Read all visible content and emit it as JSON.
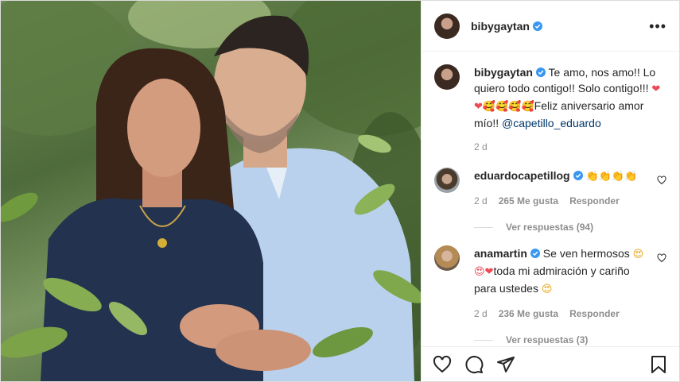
{
  "post": {
    "author": "bibygaytan",
    "caption": {
      "username": "bibygaytan",
      "text_part1": " Te amo, nos amo!! Lo quiero todo contigo!! Solo contigo!!! ",
      "emojis": "❤❤🥰🥰🥰🥰",
      "text_part2": "Feliz aniversario amor mío!! ",
      "mention": "@capetillo_eduardo",
      "time": "2 d"
    },
    "comments": [
      {
        "username": "eduardocapetillog",
        "text": "",
        "emojis": "👏👏👏👏",
        "time": "2 d",
        "likes": "265 Me gusta",
        "reply_label": "Responder",
        "view_replies": "Ver respuestas (94)"
      },
      {
        "username": "anamartin",
        "text_part1": " Se ven hermosos ",
        "emoji1": "😍",
        "emoji2": "😍❤",
        "text_part2": "toda mi admiración y cariño para ustedes ",
        "emoji3": "😍",
        "time": "2 d",
        "likes": "236 Me gusta",
        "reply_label": "Responder",
        "view_replies": "Ver respuestas (3)"
      }
    ],
    "icons": {
      "more": "more-options-icon",
      "like": "heart-icon",
      "comment": "comment-icon",
      "share": "share-icon",
      "save": "bookmark-icon",
      "verified": "verified-badge-icon"
    },
    "colors": {
      "verified": "#3897f0",
      "mention": "#00376b",
      "muted": "#8e8e8e",
      "heart": "#ed4956"
    }
  }
}
